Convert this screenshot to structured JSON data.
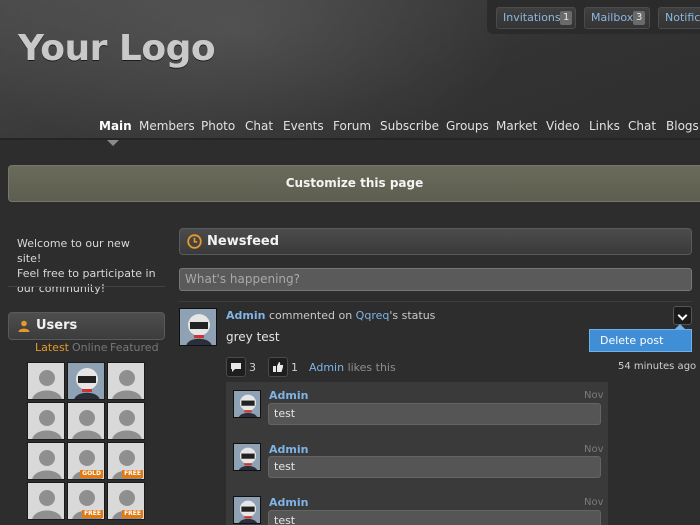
{
  "header": {
    "logo_text": "Your Logo",
    "topbar": {
      "invitations": {
        "label": "Invitations",
        "count": "1"
      },
      "mailbox": {
        "label": "Mailbox",
        "count": "3"
      },
      "notifications": {
        "label": "Notifica"
      }
    }
  },
  "nav": {
    "items": [
      "Main",
      "Members",
      "Photo",
      "Chat",
      "Events",
      "Forum",
      "Subscribe",
      "Groups",
      "Market",
      "Video",
      "Links",
      "Chat",
      "Blogs"
    ],
    "active": "Main"
  },
  "customize": {
    "label": "Customize this page"
  },
  "sidebar": {
    "welcome_text": "Welcome to our new site! Feel free to participate in our community!",
    "welcome_lines": [
      "Welcome to our new site!",
      "Feel free to participate in",
      "our community!"
    ],
    "users_title": "Users",
    "tabs": [
      "Latest",
      "Online",
      "Featured"
    ],
    "active_tab": "Latest",
    "badges": [
      "GOLD",
      "FREE",
      "FREE",
      "FREE"
    ]
  },
  "newsfeed": {
    "title": "Newsfeed",
    "status_placeholder": "What's happening?",
    "post": {
      "author": "Admin",
      "action": "commented on",
      "target_user": "Qqreq",
      "target_suffix": "'s status",
      "text": "grey test",
      "menu_item": "Delete post",
      "comment_count": "3",
      "like_count": "1",
      "liker": "Admin",
      "likes_text": "likes this",
      "time_ago": "54 minutes ago"
    },
    "comments": [
      {
        "author": "Admin",
        "date": "Nov",
        "text": "test"
      },
      {
        "author": "Admin",
        "date": "Nov",
        "text": "test"
      },
      {
        "author": "Admin",
        "date": "Nov",
        "text": "test"
      }
    ]
  },
  "colors": {
    "link": "#7fb4e6",
    "accent": "#e59a2a",
    "menu_highlight": "#3f8ed6",
    "badge": "#e07b16"
  }
}
